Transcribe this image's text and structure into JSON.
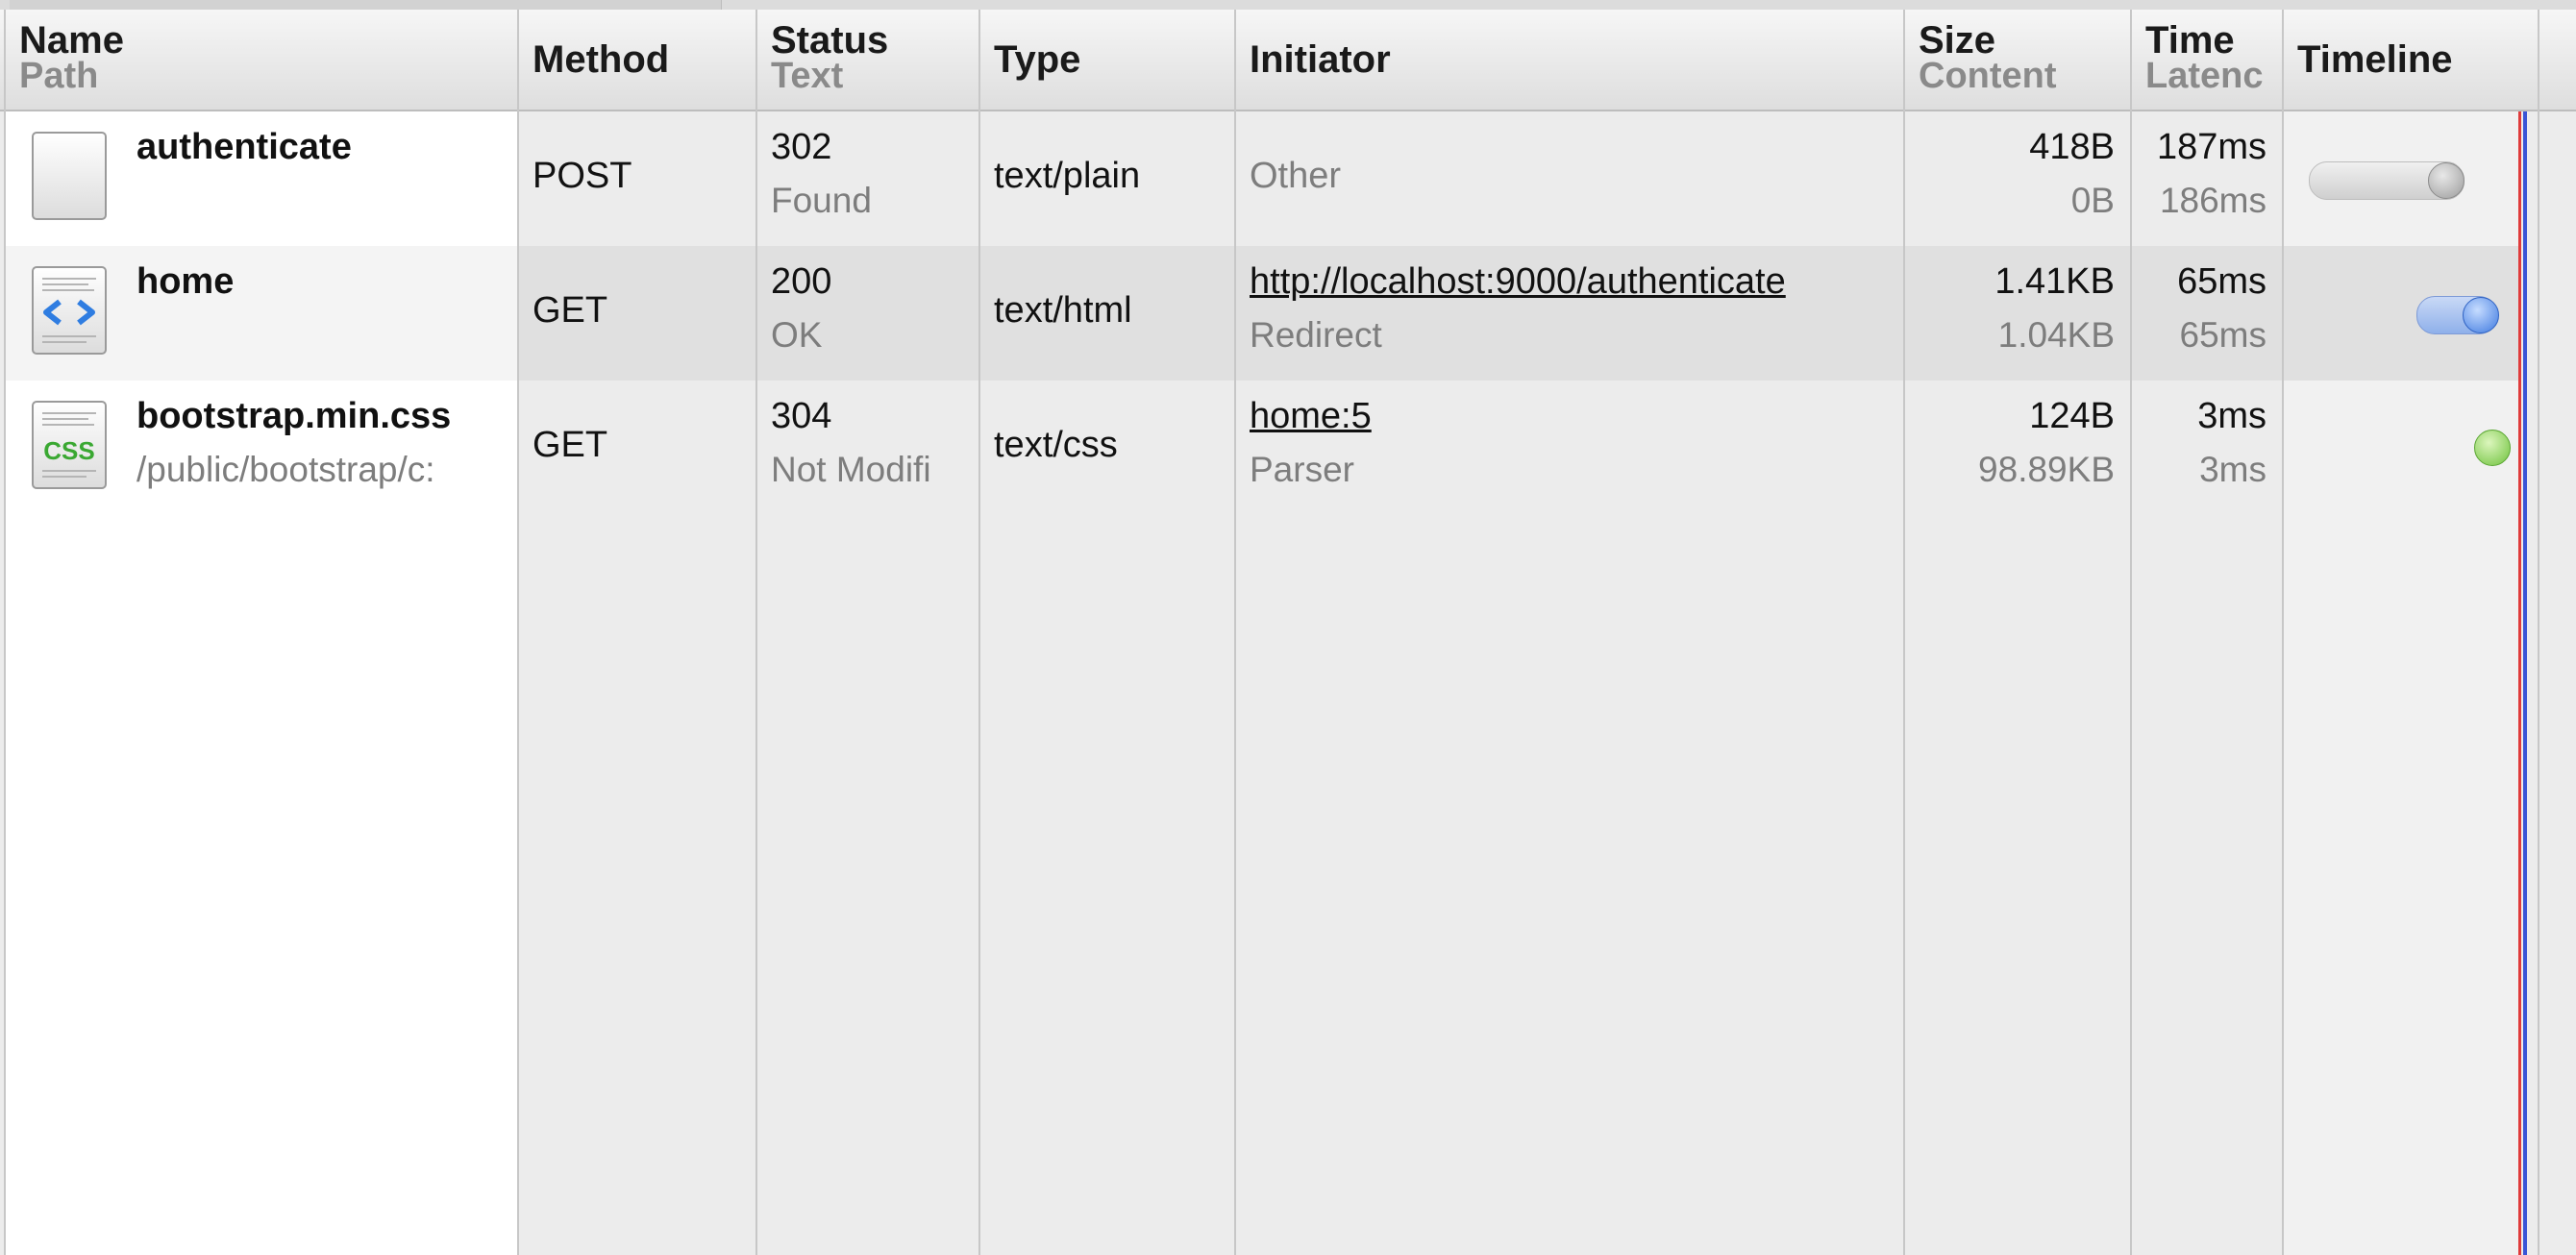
{
  "columns": {
    "name": {
      "title": "Name",
      "subtitle": "Path"
    },
    "method": {
      "title": "Method"
    },
    "status": {
      "title": "Status",
      "subtitle": "Text"
    },
    "type": {
      "title": "Type"
    },
    "initiator": {
      "title": "Initiator"
    },
    "size": {
      "title": "Size",
      "subtitle": "Content"
    },
    "time": {
      "title": "Time",
      "subtitle": "Latenc"
    },
    "timeline": {
      "title": "Timeline"
    }
  },
  "rows": [
    {
      "name": "authenticate",
      "path": "",
      "icon": "blank-document-icon",
      "method": "POST",
      "status": "302",
      "status_text": "Found",
      "type": "text/plain",
      "initiator": "",
      "initiator_sub": "Other",
      "size": "418B",
      "content": "0B",
      "time": "187ms",
      "latency": "186ms",
      "timeline_style": "gray"
    },
    {
      "name": "home",
      "path": "",
      "icon": "html-document-icon",
      "method": "GET",
      "status": "200",
      "status_text": "OK",
      "type": "text/html",
      "initiator": "http://localhost:9000/authenticate",
      "initiator_sub": "Redirect",
      "size": "1.41KB",
      "content": "1.04KB",
      "time": "65ms",
      "latency": "65ms",
      "timeline_style": "blue"
    },
    {
      "name": "bootstrap.min.css",
      "path": "/public/bootstrap/c:",
      "icon": "css-document-icon",
      "method": "GET",
      "status": "304",
      "status_text": "Not Modifi",
      "type": "text/css",
      "initiator": "home:5",
      "initiator_sub": "Parser",
      "size": "124B",
      "content": "98.89KB",
      "time": "3ms",
      "latency": "3ms",
      "timeline_style": "green"
    }
  ],
  "colors": {
    "row_alt": "#e0e0e0",
    "name_column_bg": "#ffffff",
    "timeline_red_marker": "#e03b3b",
    "timeline_blue_marker": "#3a55d6",
    "html_icon_blue": "#2f7de1",
    "css_icon_green": "#3aa832"
  }
}
